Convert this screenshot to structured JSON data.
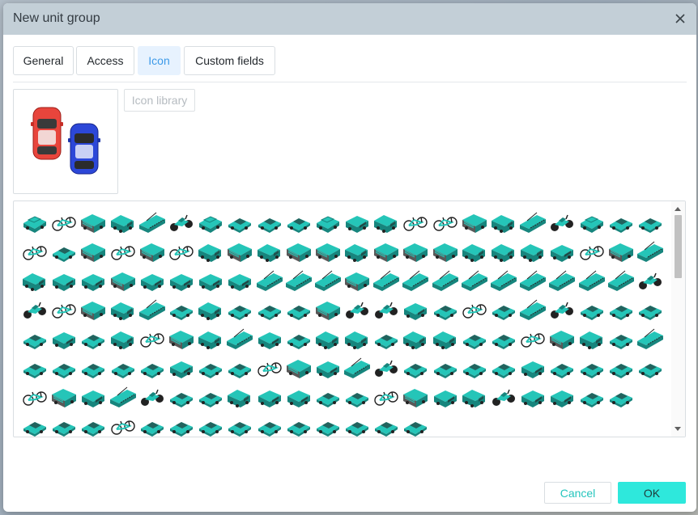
{
  "dialog": {
    "title": "New unit group",
    "close_icon": "close-icon"
  },
  "tabs": [
    {
      "label": "General",
      "active": false
    },
    {
      "label": "Access",
      "active": false
    },
    {
      "label": "Icon",
      "active": true
    },
    {
      "label": "Custom fields",
      "active": false
    }
  ],
  "preview": {
    "icon": "two-cars-icon",
    "car_colors": [
      "#e8453c",
      "#2c47d8"
    ]
  },
  "icon_library": {
    "label": "Icon library"
  },
  "icon_grid": {
    "accent_color": "#25c5b8",
    "icon_names": [
      "vehicle-icon",
      "bicycle-icon",
      "bus-icon",
      "truck-icon",
      "van-icon",
      "car-icon",
      "tram-icon",
      "motorbike-icon"
    ],
    "cells": [
      "vehicle-icon",
      "bicycle-icon",
      "bus-icon",
      "truck-icon",
      "tram-icon",
      "motorbike-icon",
      "vehicle-icon",
      "car-icon",
      "car-icon",
      "car-icon",
      "vehicle-icon",
      "van-icon",
      "truck-icon",
      "bicycle-icon",
      "bicycle-icon",
      "bus-icon",
      "truck-icon",
      "tram-icon",
      "motorbike-icon",
      "vehicle-icon",
      "car-icon",
      "car-icon",
      "bicycle-icon",
      "car-icon",
      "bus-icon",
      "bicycle-icon",
      "bus-icon",
      "bicycle-icon",
      "truck-icon",
      "bus-icon",
      "truck-icon",
      "bus-icon",
      "bus-icon",
      "truck-icon",
      "bus-icon",
      "bus-icon",
      "bus-icon",
      "truck-icon",
      "truck-icon",
      "truck-icon",
      "van-icon",
      "bicycle-icon",
      "bus-icon",
      "tram-icon",
      "truck-icon",
      "van-icon",
      "van-icon",
      "bus-icon",
      "van-icon",
      "van-icon",
      "van-icon",
      "van-icon",
      "tram-icon",
      "tram-icon",
      "tram-icon",
      "bus-icon",
      "tram-icon",
      "tram-icon",
      "tram-icon",
      "tram-icon",
      "tram-icon",
      "tram-icon",
      "tram-icon",
      "tram-icon",
      "tram-icon",
      "motorbike-icon",
      "motorbike-icon",
      "bicycle-icon",
      "bus-icon",
      "truck-icon",
      "tram-icon",
      "car-icon",
      "truck-icon",
      "car-icon",
      "car-icon",
      "car-icon",
      "bus-icon",
      "motorbike-icon",
      "motorbike-icon",
      "van-icon",
      "car-icon",
      "bicycle-icon",
      "car-icon",
      "tram-icon",
      "motorbike-icon",
      "car-icon",
      "car-icon",
      "car-icon",
      "car-icon",
      "van-icon",
      "car-icon",
      "truck-icon",
      "bicycle-icon",
      "bus-icon",
      "truck-icon",
      "tram-icon",
      "van-icon",
      "car-icon",
      "truck-icon",
      "truck-icon",
      "car-icon",
      "truck-icon",
      "truck-icon",
      "car-icon",
      "car-icon",
      "bicycle-icon",
      "bus-icon",
      "truck-icon",
      "car-icon",
      "tram-icon",
      "car-icon",
      "car-icon",
      "car-icon",
      "car-icon",
      "car-icon",
      "van-icon",
      "car-icon",
      "car-icon",
      "bicycle-icon",
      "bus-icon",
      "van-icon",
      "tram-icon",
      "motorbike-icon",
      "car-icon",
      "car-icon",
      "car-icon",
      "car-icon",
      "van-icon",
      "car-icon",
      "car-icon",
      "car-icon",
      "car-icon",
      "bicycle-icon",
      "bus-icon",
      "van-icon",
      "tram-icon",
      "motorbike-icon",
      "car-icon",
      "car-icon",
      "truck-icon",
      "van-icon",
      "van-icon",
      "car-icon",
      "car-icon",
      "bicycle-icon",
      "bus-icon",
      "van-icon",
      "truck-icon",
      "motorbike-icon",
      "van-icon",
      "van-icon",
      "car-icon",
      "car-icon",
      "",
      "car-icon",
      "car-icon",
      "car-icon",
      "bicycle-icon",
      "car-icon",
      "car-icon",
      "car-icon",
      "car-icon",
      "car-icon",
      "car-icon",
      "car-icon",
      "car-icon",
      "car-icon",
      "car-icon",
      "",
      "",
      "",
      "",
      "",
      "",
      "",
      ""
    ]
  },
  "footer": {
    "cancel_label": "Cancel",
    "ok_label": "OK"
  }
}
